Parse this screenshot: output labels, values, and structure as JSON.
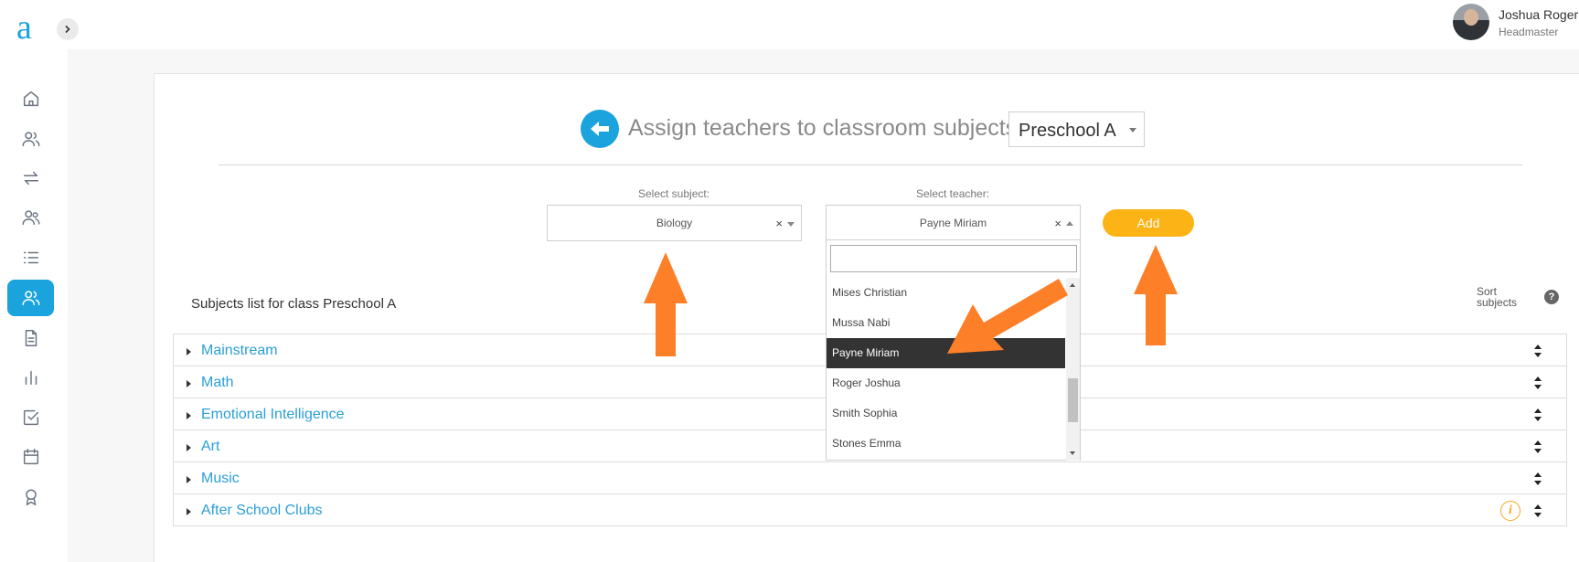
{
  "app": {
    "logo": "a"
  },
  "sidebar": {
    "items": [
      {
        "icon": "home-icon"
      },
      {
        "icon": "users-icon"
      },
      {
        "icon": "swap-icon"
      },
      {
        "icon": "group-icon"
      },
      {
        "icon": "list-icon"
      },
      {
        "icon": "teacher-assign-icon",
        "active": true
      },
      {
        "icon": "document-icon"
      },
      {
        "icon": "bar-chart-icon"
      },
      {
        "icon": "checkbox-icon"
      },
      {
        "icon": "calendar-icon"
      },
      {
        "icon": "award-icon"
      }
    ]
  },
  "header": {
    "user_name": "Joshua Roger",
    "user_role": "Headmaster"
  },
  "page": {
    "title": "Assign teachers to classroom subjects",
    "class_selected": "Preschool A"
  },
  "form": {
    "subject_label": "Select subject:",
    "subject_value": "Biology",
    "teacher_label": "Select teacher:",
    "teacher_value": "Payne Miriam",
    "clear_glyph": "×",
    "add_label": "Add"
  },
  "teacher_dropdown": {
    "search_value": "",
    "options": [
      "Mises Christian",
      "Mussa Nabi",
      "Payne Miriam",
      "Roger Joshua",
      "Smith Sophia",
      "Stones Emma"
    ],
    "selected_index": 2
  },
  "subjects_list": {
    "heading": "Subjects list for class Preschool A",
    "sort_label": "Sort subjects",
    "help_glyph": "?",
    "items": [
      "Mainstream",
      "Math",
      "Emotional Intelligence",
      "Art",
      "Music",
      "After School Clubs"
    ],
    "info_glyph": "i"
  },
  "colors": {
    "accent": "#1aa3dc",
    "add_button": "#fbb315",
    "annotation_arrow": "#fd7f28",
    "selected_option": "#333333",
    "subject_link": "#2a9fd6"
  }
}
